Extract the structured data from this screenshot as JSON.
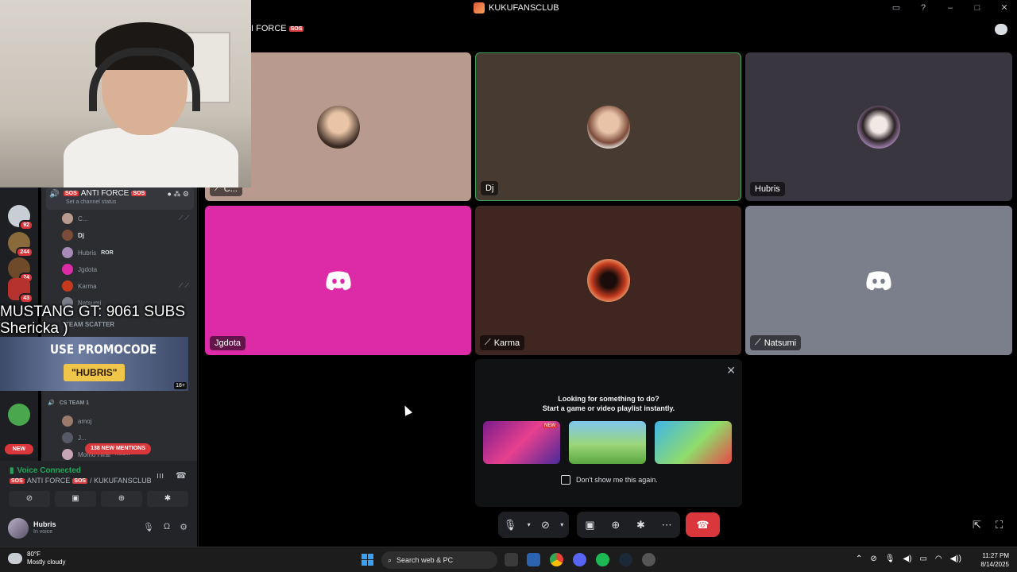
{
  "window": {
    "title": "KUKUFANSCLUB"
  },
  "channel_header": {
    "name": "I FORCE",
    "sos": "SOS"
  },
  "tiles": [
    {
      "name": "C...",
      "bg": "#b89a8e",
      "speaking": false
    },
    {
      "name": "Dj",
      "bg": "#463a31",
      "speaking": true
    },
    {
      "name": "Hubris",
      "bg": "#3a3640",
      "speaking": false
    },
    {
      "name": "Jgdota",
      "bg": "#dd2aa6",
      "speaking": false
    },
    {
      "name": "Karma",
      "bg": "#3f2620",
      "speaking": false
    },
    {
      "name": "Natsumi",
      "bg": "#7b7f8c",
      "speaking": false
    }
  ],
  "activity": {
    "prompt_line1": "Looking for something to do?",
    "prompt_line2": "Start a game or video playlist instantly.",
    "games": [
      {
        "icon": "the-last-meme-show-game",
        "new_badge": "NEW"
      },
      {
        "icon": "putt-party-game"
      },
      {
        "icon": "merge-game"
      }
    ],
    "dont_show": "Don't show me this again."
  },
  "sidebar": {
    "voice_channel": "ANTI FORCE",
    "sos": "SOS",
    "channel_status": "Set a channel status",
    "members": [
      {
        "name": "C...",
        "muted": true
      },
      {
        "name": "Dj",
        "muted": false
      },
      {
        "name": "Hubris",
        "tag": "ROR",
        "muted": false
      },
      {
        "name": "Jgdota",
        "muted": false
      },
      {
        "name": "Karma",
        "muted": true
      },
      {
        "name": "Natsumi",
        "muted": true
      }
    ],
    "category_team": "TEAM SCATTER",
    "cs_team": "CS TEAM 1",
    "cs_members": [
      {
        "name": "amoj"
      },
      {
        "name": "J..."
      },
      {
        "name": "Momo Hirai",
        "tag": "MEOW"
      }
    ],
    "guild_badges": [
      "92",
      "244",
      "24",
      "43"
    ],
    "new_pill": "NEW",
    "mentions": "138 NEW MENTIONS"
  },
  "overlay": {
    "subs_line1": "MUSTANG GT: 9061 SUBS",
    "subs_line2": "Shericka )",
    "promo_line1": "USE PROMOCODE",
    "promo_line2": "\"HUBRIS\"",
    "promo_age": "18+"
  },
  "voice_panel": {
    "status": "Voice Connected",
    "location": "ANTI FORCE",
    "sos": "SOS",
    "server": "/ KUKUFANSCLUB"
  },
  "user": {
    "name": "Hubris",
    "status": "In voice"
  },
  "taskbar": {
    "temp": "80°F",
    "weather": "Mostly cloudy",
    "search": "Search web & PC",
    "time": "11:27 PM",
    "date": "8/14/2025"
  },
  "colors": {
    "accent": "#5865f2",
    "danger": "#da373c",
    "green": "#23a55a"
  }
}
